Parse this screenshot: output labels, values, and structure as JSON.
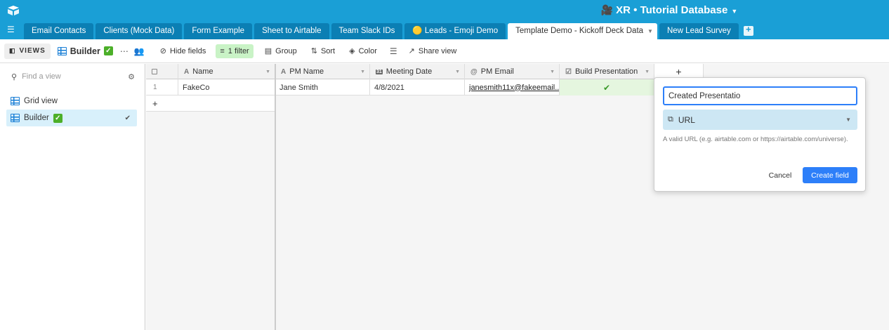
{
  "app": {
    "base_title": "XR • Tutorial Database",
    "base_emoji": "🎥",
    "colors": {
      "topbar": "#1a9fd6",
      "tab_inactive": "#0b7fb4",
      "filter_active": "#c9f3c6",
      "primary": "#2d7ff9",
      "selected_view": "#d8f0fb"
    }
  },
  "tabs": [
    {
      "label": "Email Contacts"
    },
    {
      "label": "Clients (Mock Data)"
    },
    {
      "label": "Form Example"
    },
    {
      "label": "Sheet to Airtable"
    },
    {
      "label": "Team Slack IDs"
    },
    {
      "label": "🟡 Leads - Emoji Demo"
    },
    {
      "label": "Template Demo - Kickoff Deck Data",
      "active": true
    },
    {
      "label": "New Lead Survey"
    }
  ],
  "toolbar": {
    "views_label": "VIEWS",
    "view_name": "Builder",
    "view_emoji": "✓",
    "hide_fields": "Hide fields",
    "filter": "1 filter",
    "group": "Group",
    "sort": "Sort",
    "color": "Color",
    "share_view": "Share view"
  },
  "sidebar": {
    "find_placeholder": "Find a view",
    "views": [
      {
        "label": "Grid view",
        "selected": false
      },
      {
        "label": "Builder",
        "emoji": "✓",
        "selected": true
      }
    ]
  },
  "grid": {
    "columns": [
      {
        "label": "Name",
        "type_icon": "A"
      },
      {
        "label": "PM Name",
        "type_icon": "A"
      },
      {
        "label": "Meeting Date",
        "type_icon": "31"
      },
      {
        "label": "PM Email",
        "type_icon": "@"
      },
      {
        "label": "Build Presentation",
        "type_icon": "☑"
      }
    ],
    "rows": [
      {
        "num": "1",
        "name": "FakeCo",
        "pm_name": "Jane Smith",
        "meeting_date": "4/8/2021",
        "pm_email": "janesmith11x@fakeemail....",
        "build_presentation": "✔"
      }
    ],
    "add_row": "+",
    "add_column": "+"
  },
  "popover": {
    "field_name_value": "Created Presentatio",
    "field_type": "URL",
    "description": "A valid URL (e.g. airtable.com or https://airtable.com/universe).",
    "cancel": "Cancel",
    "create": "Create field"
  }
}
